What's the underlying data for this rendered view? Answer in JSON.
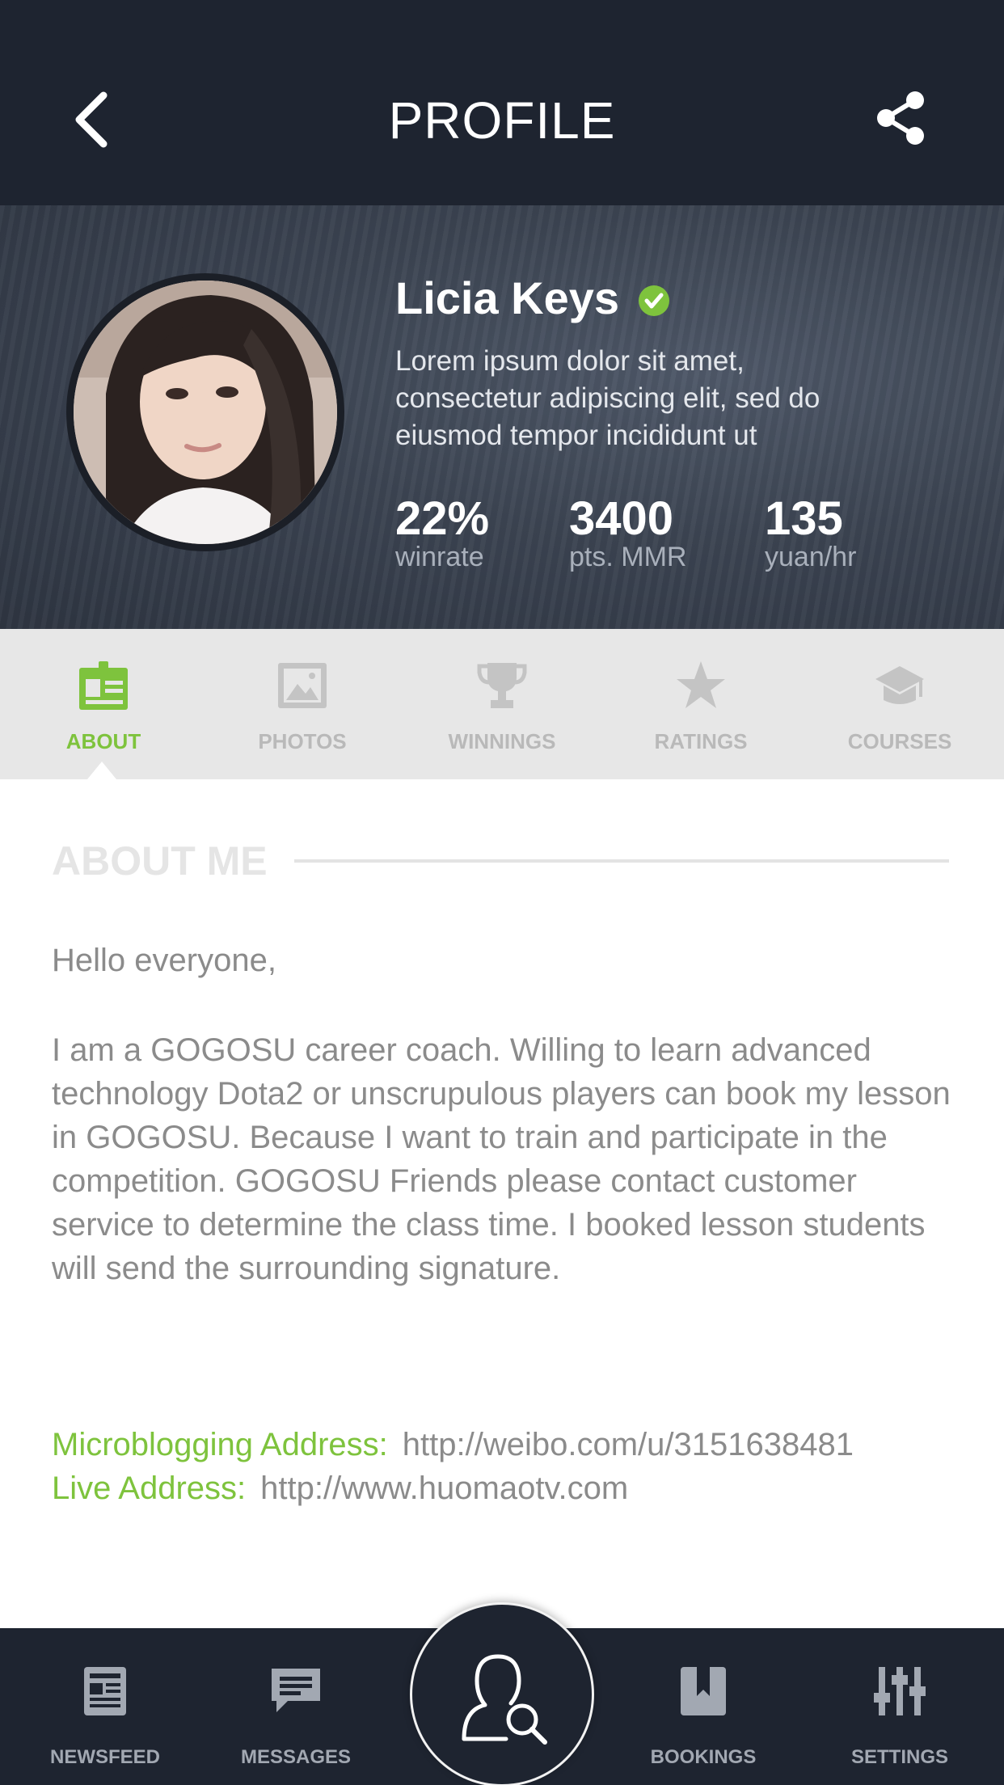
{
  "header": {
    "title": "PROFILE",
    "back_icon": "chevron-left-icon",
    "share_icon": "share-icon"
  },
  "profile": {
    "name": "Licia Keys",
    "verified": true,
    "bio": "Lorem ipsum dolor sit amet, consectetur adipiscing elit, sed do eiusmod tempor incididunt ut",
    "stats": [
      {
        "value": "22%",
        "label": "winrate"
      },
      {
        "value": "3400",
        "label": "pts. MMR"
      },
      {
        "value": "135",
        "label": "yuan/hr"
      }
    ]
  },
  "tabs": [
    {
      "label": "ABOUT",
      "icon": "profile-card-icon",
      "active": true
    },
    {
      "label": "PHOTOS",
      "icon": "photo-icon",
      "active": false
    },
    {
      "label": "WINNINGS",
      "icon": "trophy-icon",
      "active": false
    },
    {
      "label": "RATINGS",
      "icon": "star-icon",
      "active": false
    },
    {
      "label": "COURSES",
      "icon": "graduation-cap-icon",
      "active": false
    }
  ],
  "about": {
    "heading": "ABOUT ME",
    "greeting": "Hello everyone,",
    "body": "I am a GOGOSU career coach. Willing to learn advanced technology Dota2 or unscrupulous players can book my lesson in GOGOSU. Because I want to train and participate in the competition.  GOGOSU Friends please contact customer service to determine the class time. I booked lesson students will send the surrounding signature.",
    "addresses": [
      {
        "label": "Microblogging Address:",
        "value": "http://weibo.com/u/3151638481"
      },
      {
        "label": "Live Address:",
        "value": "http://www.huomaotv.com"
      }
    ]
  },
  "bottom_nav": [
    {
      "label": "NEWSFEED",
      "icon": "newspaper-icon"
    },
    {
      "label": "MESSAGES",
      "icon": "chat-icon"
    },
    {
      "label": "BOOKINGS",
      "icon": "bookmark-icon"
    },
    {
      "label": "SETTINGS",
      "icon": "sliders-icon"
    }
  ],
  "center_action": {
    "icon": "user-search-icon"
  },
  "colors": {
    "accent": "#7ec33d",
    "header_bg": "#1e2430",
    "tab_bg": "#e7e7e7",
    "muted_text": "#8b8b8b"
  }
}
